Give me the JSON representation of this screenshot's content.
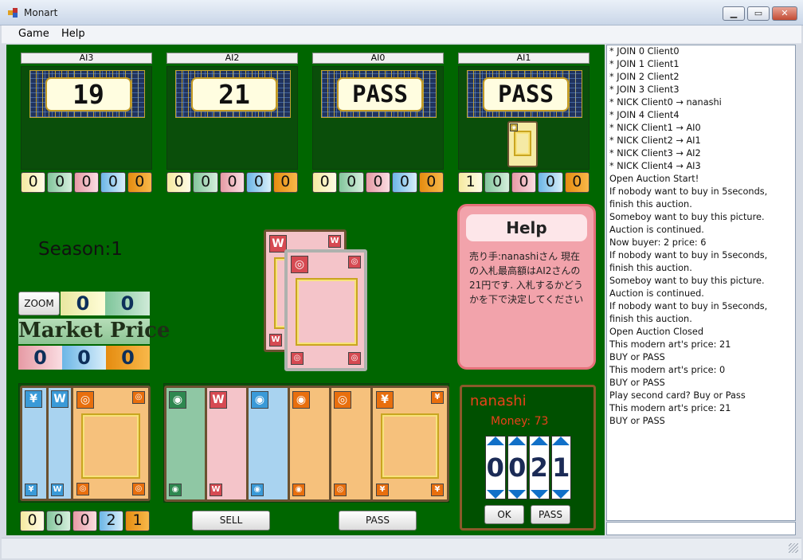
{
  "window": {
    "title": "Monart",
    "min": "▁",
    "max": "▭",
    "close": "✕"
  },
  "menu": [
    "Game",
    "Help"
  ],
  "players": [
    {
      "name": "AI3",
      "bid": "19",
      "counters": [
        "0",
        "0",
        "0",
        "0",
        "0"
      ]
    },
    {
      "name": "AI2",
      "bid": "21",
      "counters": [
        "0",
        "0",
        "0",
        "0",
        "0"
      ]
    },
    {
      "name": "AI0",
      "bid": "PASS",
      "counters": [
        "0",
        "0",
        "0",
        "0",
        "0"
      ]
    },
    {
      "name": "AI1",
      "bid": "PASS",
      "counters": [
        "1",
        "0",
        "0",
        "0",
        "0"
      ]
    }
  ],
  "season": "Season:1",
  "zoom": "ZOOM",
  "zoom_counters": [
    "0",
    "0"
  ],
  "market": {
    "title": "Market Price",
    "values": [
      "0",
      "0",
      "0"
    ]
  },
  "my_counters": [
    "0",
    "0",
    "0",
    "2",
    "1"
  ],
  "icons": {
    "yen": "¥",
    "w": "W",
    "eye": "◉",
    "ring": "◎"
  },
  "buttons": {
    "sell": "SELL",
    "pass": "PASS",
    "ok": "OK",
    "pass2": "PASS"
  },
  "help": {
    "title": "Help",
    "text": "売り手:nanashiさん 現在の入札最高額はAI2さんの21円です. 入札するかどうかを下で決定してください"
  },
  "me": {
    "name": "nanashi",
    "money": "Money: 73",
    "digits": [
      "0",
      "0",
      "2",
      "1"
    ]
  },
  "log": [
    "* JOIN 0 Client0",
    "* JOIN 1 Client1",
    "* JOIN 2 Client2",
    "* JOIN 3 Client3",
    "* NICK Client0 → nanashi",
    "* JOIN 4 Client4",
    "* NICK Client1 → AI0",
    "* NICK Client2 → AI1",
    "* NICK Client3 → AI2",
    "* NICK Client4 → AI3",
    "Open Auction Start!",
    "If nobody want to buy in 5seconds, finish this auction.",
    "Someboy want to buy this picture. Auction is continued.",
    "Now buyer: 2 price: 6",
    "If nobody want to buy in 5seconds, finish this auction.",
    "Someboy want to buy this picture. Auction is continued.",
    "If nobody want to buy in 5seconds, finish this auction.",
    "Open Auction Closed",
    "This modern art's price: 21",
    "BUY or PASS",
    "This modern art's price: 0",
    "BUY or PASS",
    "Play second card? Buy or Pass",
    "This modern art's price: 21",
    "BUY or PASS"
  ],
  "colors": {
    "board": "#006600",
    "orange": "#e86f0e",
    "pink": "#d64a52",
    "blue": "#3a9ad8",
    "green": "#2e8850",
    "yellow": "#c1a42e"
  }
}
